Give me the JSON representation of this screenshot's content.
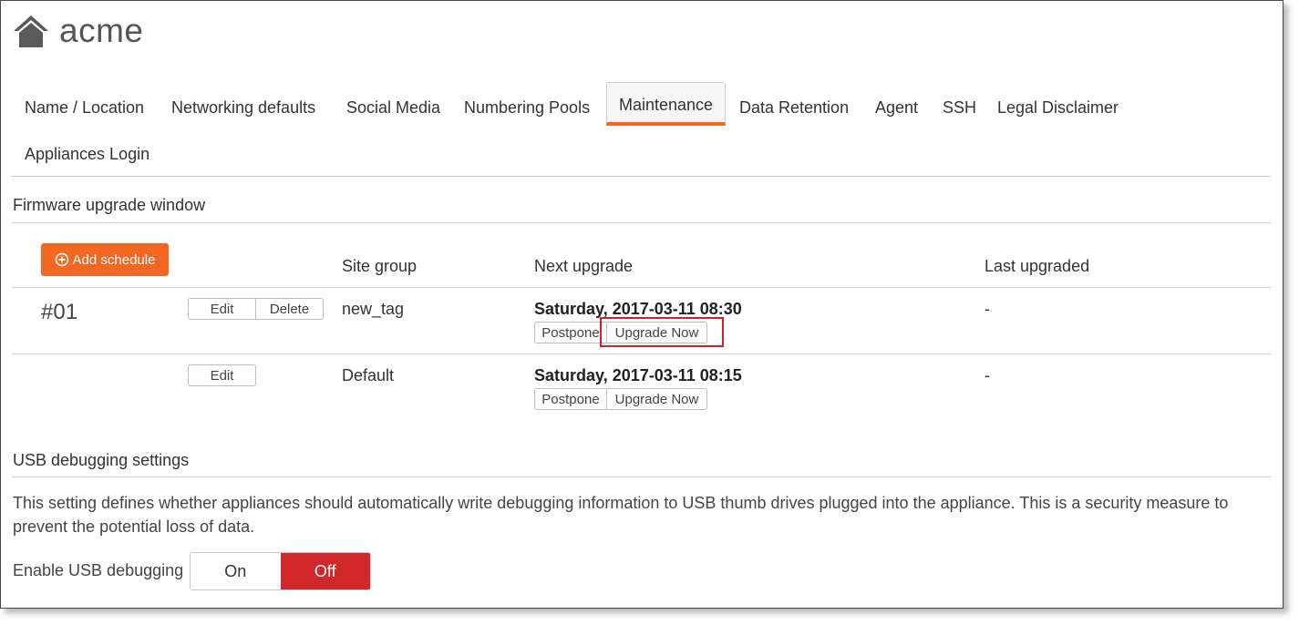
{
  "app": {
    "title": "acme"
  },
  "tabs": [
    {
      "label": "Name / Location"
    },
    {
      "label": "Networking defaults"
    },
    {
      "label": "Social Media"
    },
    {
      "label": "Numbering Pools"
    },
    {
      "label": "Maintenance"
    },
    {
      "label": "Data Retention"
    },
    {
      "label": "Agent"
    },
    {
      "label": "SSH"
    },
    {
      "label": "Legal Disclaimer"
    },
    {
      "label": "Appliances Login"
    }
  ],
  "active_tab": "Maintenance",
  "firmware": {
    "title": "Firmware upgrade window",
    "add_schedule_label": "Add schedule",
    "columns": {
      "site_group": "Site group",
      "next_upgrade": "Next upgrade",
      "last_upgraded": "Last upgraded"
    },
    "rows": [
      {
        "id": "#01",
        "edit_label": "Edit",
        "delete_label": "Delete",
        "site_group": "new_tag",
        "next_upgrade": "Saturday, 2017-03-11 08:30",
        "postpone_label": "Postpone",
        "upgrade_now_label": "Upgrade Now",
        "last_upgraded": "-"
      },
      {
        "id": "",
        "edit_label": "Edit",
        "site_group": "Default",
        "next_upgrade": "Saturday, 2017-03-11 08:15",
        "postpone_label": "Postpone",
        "upgrade_now_label": "Upgrade Now",
        "last_upgraded": "-"
      }
    ]
  },
  "usb": {
    "title": "USB debugging settings",
    "description": "This setting defines whether appliances should automatically write debugging information to USB thumb drives plugged into the appliance. This is a security measure to prevent the potential loss of data.",
    "toggle_label": "Enable USB debugging",
    "on_label": "On",
    "off_label": "Off",
    "selected": "Off"
  },
  "colors": {
    "accent": "#f26722",
    "off_active": "#d0272b",
    "highlight": "#d0202a"
  }
}
